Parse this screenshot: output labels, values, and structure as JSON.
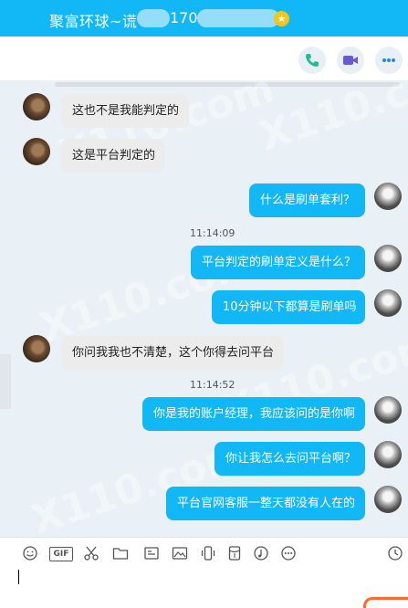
{
  "header": {
    "contact_name": "聚富环球~谎",
    "contact_number": "170"
  },
  "messages": [
    {
      "side": "left",
      "text": "这也不是我能判定的"
    },
    {
      "side": "left",
      "text": "这是平台判定的"
    },
    {
      "side": "right",
      "text": "什么是刷单套利？"
    },
    {
      "side": "time",
      "text": "11:14:09"
    },
    {
      "side": "right",
      "text": "平台判定的刷单定义是什么？"
    },
    {
      "side": "right",
      "text": "10分钟以下都算是刷单吗"
    },
    {
      "side": "left",
      "text": "你问我我也不清楚，这个你得去问平台"
    },
    {
      "side": "time",
      "text": "11:14:52"
    },
    {
      "side": "right",
      "text": "你是我的账户经理，我应该问的是你啊"
    },
    {
      "side": "right",
      "text": "你让我怎么去问平台啊？"
    },
    {
      "side": "right",
      "text": "平台官网客服一整天都没有人在的"
    }
  ],
  "watermark": "X110.com",
  "input_tools": {
    "gif_label": "GIF"
  },
  "colors": {
    "brand": "#12b7f5",
    "chat_bg": "#eaf1f6",
    "phone": "#1fbf8f",
    "video": "#6a58d6"
  },
  "icons": [
    "phone-icon",
    "video-icon",
    "more-icon",
    "emoji-icon",
    "gif-icon",
    "scissors-icon",
    "folder-icon",
    "image-icon",
    "screen-icon",
    "shake-icon",
    "red-packet-icon",
    "music-icon",
    "more-tools-icon",
    "history-icon"
  ]
}
